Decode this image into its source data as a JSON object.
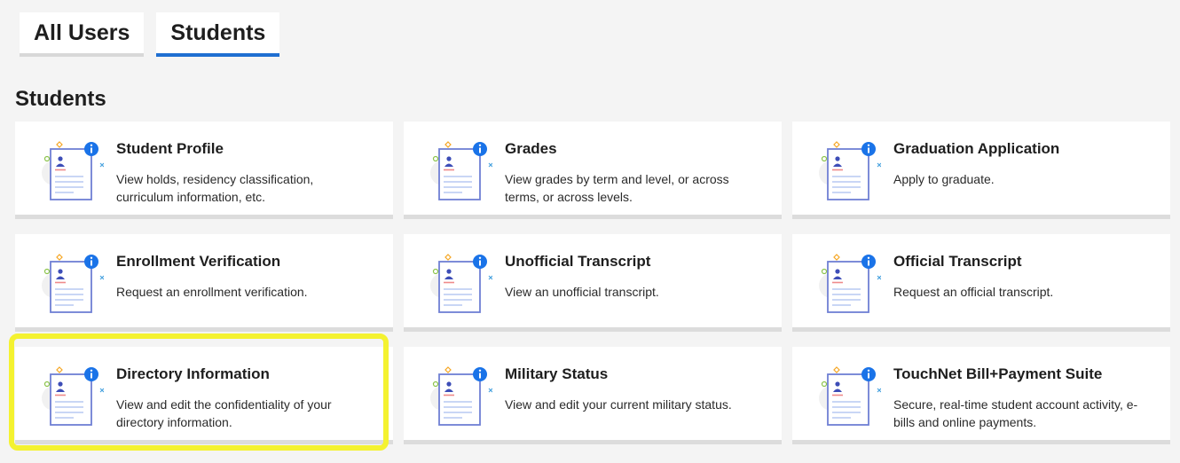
{
  "tabs": [
    {
      "label": "All Users",
      "active": false
    },
    {
      "label": "Students",
      "active": true
    }
  ],
  "section_title": "Students",
  "cards": [
    {
      "title": "Student Profile",
      "description": "View holds, residency classification, curriculum information, etc."
    },
    {
      "title": "Grades",
      "description": "View grades by term and level, or across terms, or across levels."
    },
    {
      "title": "Graduation Application",
      "description": "Apply to graduate."
    },
    {
      "title": "Enrollment Verification",
      "description": "Request an enrollment verification."
    },
    {
      "title": "Unofficial Transcript",
      "description": "View an unofficial transcript."
    },
    {
      "title": "Official Transcript",
      "description": "Request an official transcript."
    },
    {
      "title": "Directory Information",
      "description": "View and edit the confidentiality of your directory information."
    },
    {
      "title": "Military Status",
      "description": "View and edit your current military status."
    },
    {
      "title": "TouchNet Bill+Payment Suite",
      "description": "Secure, real-time student account activity, e-bills and online payments."
    }
  ],
  "card_icon": "profile-document-icon",
  "colors": {
    "active_tab": "#1f6fd1",
    "info_badge": "#1a73e8",
    "highlight": "#f4f230",
    "icon_stroke": "#6f7fd4"
  }
}
